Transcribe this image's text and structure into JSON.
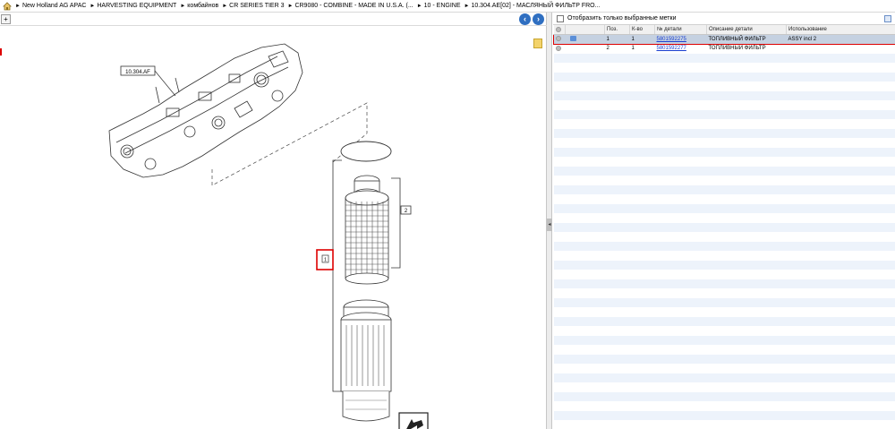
{
  "breadcrumb": {
    "items": [
      "New Holland AG APAC",
      "HARVESTING EQUIPMENT",
      "комбайнов",
      "CR SERIES TIER 3",
      "CR9080 - COMBINE - MADE IN U.S.A. (...",
      "10 - ENGINE",
      "10.304.AE[02] - МАСЛЯНЫЙ ФИЛЬТР FRO..."
    ]
  },
  "diagram": {
    "ref_label": "10.304.AF",
    "callout_1": "1",
    "callout_2": "2"
  },
  "parts_panel": {
    "filter_label": "Отобразить только выбранные метки",
    "columns": [
      "Поз.",
      "К-во",
      "№ детали",
      "Описание детали",
      "Использование"
    ],
    "rows": [
      {
        "pos": "1",
        "qty": "1",
        "part_no": "5801592275",
        "description": "ТОПЛИВНЫЙ ФИЛЬТР",
        "usage": "ASSY incl 2"
      },
      {
        "pos": "2",
        "qty": "1",
        "part_no": "5801592277",
        "description": "ТОПЛИВНЫЙ ФИЛЬТР",
        "usage": ""
      }
    ]
  },
  "colors": {
    "selection_border": "#dd0000",
    "selected_row": "#c5d1e1",
    "stripe": "#edf3fb",
    "link": "#1a3fd0",
    "nav_button": "#2f6fc1"
  }
}
